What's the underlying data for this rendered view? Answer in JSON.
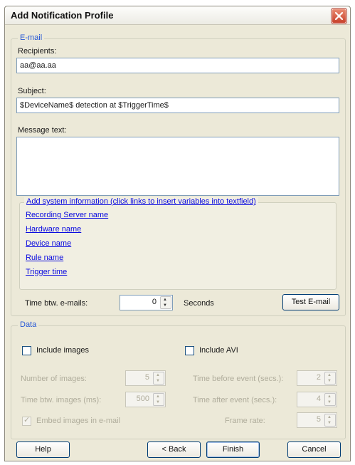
{
  "window": {
    "title": "Add Notification Profile",
    "close_icon": "close-icon"
  },
  "email": {
    "group_label": "E-mail",
    "recipients_label": "Recipients:",
    "recipients_value": "aa@aa.aa",
    "subject_label": "Subject:",
    "subject_value": "$DeviceName$ detection at $TriggerTime$",
    "message_label": "Message text:",
    "message_value": "",
    "sysinfo": {
      "label": "Add system information (click links to insert variables into textfield)",
      "links": [
        "Recording Server name",
        "Hardware name",
        "Device name",
        "Rule name",
        "Trigger time"
      ]
    },
    "time_btw_label": "Time btw. e-mails:",
    "time_btw_value": "0",
    "seconds_label": "Seconds",
    "test_button": "Test E-mail"
  },
  "data": {
    "group_label": "Data",
    "include_images_label": "Include images",
    "include_images_checked": false,
    "include_avi_label": "Include AVI",
    "include_avi_checked": false,
    "number_images_label": "Number of images:",
    "number_images_value": "5",
    "time_btw_images_label": "Time btw. images (ms):",
    "time_btw_images_value": "500",
    "embed_label": "Embed images in e-mail",
    "embed_checked": true,
    "time_before_label": "Time before event (secs.):",
    "time_before_value": "2",
    "time_after_label": "Time after event (secs.):",
    "time_after_value": "4",
    "frame_rate_label": "Frame rate:",
    "frame_rate_value": "5"
  },
  "buttons": {
    "help": "Help",
    "back": "< Back",
    "finish": "Finish",
    "cancel": "Cancel"
  }
}
